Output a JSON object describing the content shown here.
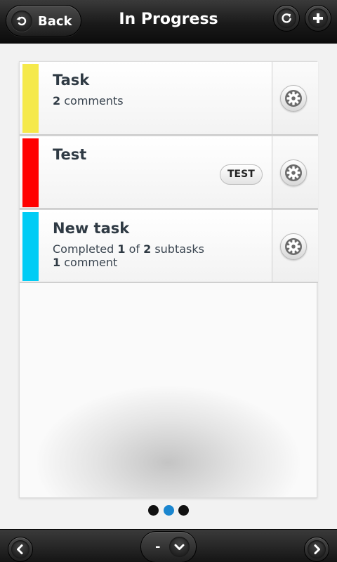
{
  "header": {
    "back_label": "Back",
    "title": "In Progress",
    "icons": {
      "back": "back-arrow-icon",
      "refresh": "refresh-icon",
      "add": "plus-icon"
    }
  },
  "tasks": [
    {
      "title": "Task",
      "color": "#f5e94b",
      "meta_line1": {
        "count": "2",
        "text": " comments"
      },
      "tag": "",
      "settings_icon": "gear-icon"
    },
    {
      "title": "Test",
      "color": "#ff0000",
      "tag": "TEST",
      "settings_icon": "gear-icon"
    },
    {
      "title": "New task",
      "color": "#00ccf5",
      "meta_line1": {
        "prefix": "Completed ",
        "done": "1",
        "mid": " of ",
        "total": "2",
        "suffix": " subtasks"
      },
      "meta_line2": {
        "count": "1",
        "text": " comment"
      },
      "settings_icon": "gear-icon"
    }
  ],
  "pager": {
    "pages": 3,
    "active_index": 1,
    "active_color": "#1a86cf"
  },
  "footer": {
    "filter_label": "-",
    "icons": {
      "prev": "chevron-left-icon",
      "filter": "chevron-down-icon",
      "next": "chevron-right-icon"
    }
  }
}
